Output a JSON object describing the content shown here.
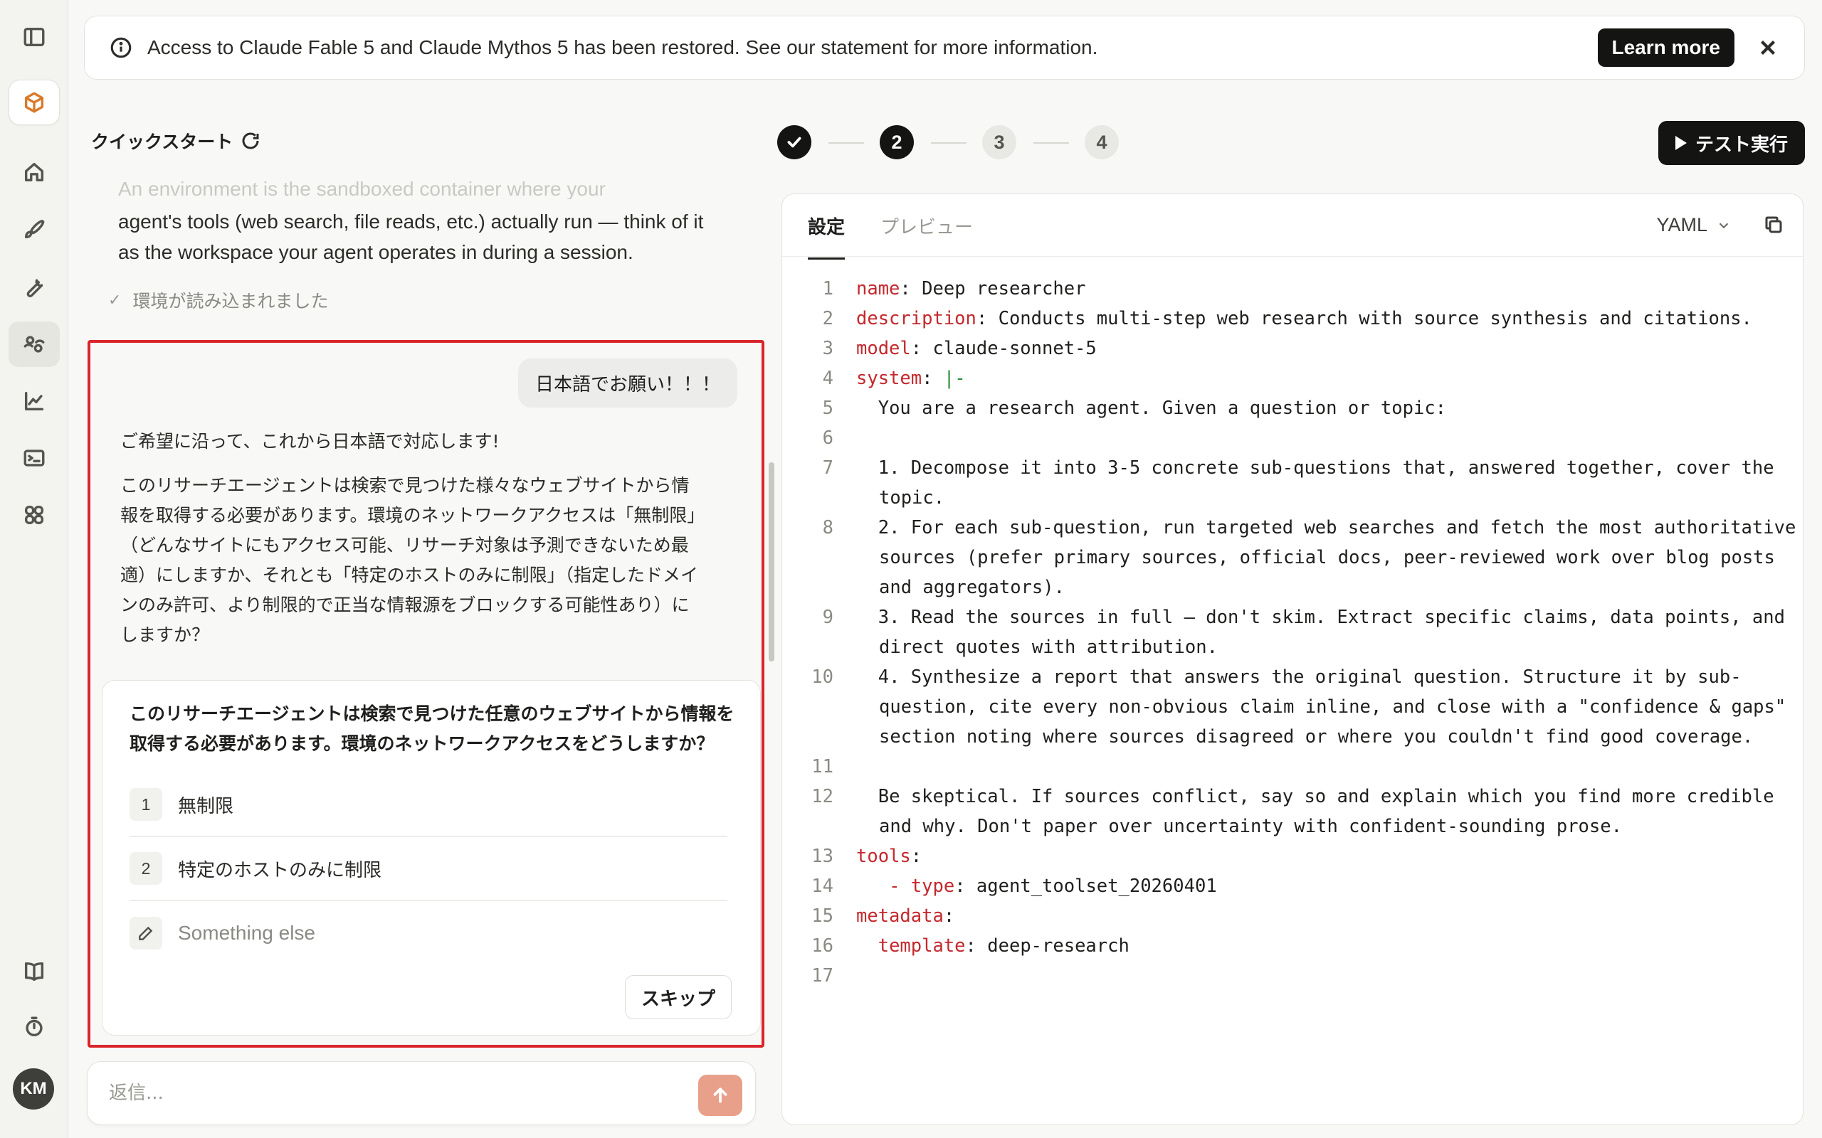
{
  "banner": {
    "text": "Access to Claude Fable 5 and Claude Mythos 5 has been restored. See our statement for more information.",
    "learn_more": "Learn more"
  },
  "sidebar": {
    "avatar_initials": "KM"
  },
  "quickstart": {
    "title": "クイックスタート",
    "faded_text": "An environment is the sandboxed container where your",
    "env_text": "agent's tools (web search, file reads, etc.) actually run — think of it as the workspace your agent operates in during a session.",
    "env_loaded": "環境が読み込まれました"
  },
  "chat": {
    "user_message": "日本語でお願い！！！",
    "assistant_p1": "ご希望に沿って、これから日本語で対応します!",
    "assistant_p2": "このリサーチエージェントは検索で見つけた様々なウェブサイトから情報を取得する必要があります。環境のネットワークアクセスは「無制限」（どんなサイトにもアクセス可能、リサーチ対象は予測できないため最適）にしますか、それとも「特定のホストのみに制限」（指定したドメインのみ許可、より制限的で正当な情報源をブロックする可能性あり）にしますか？",
    "question": "このリサーチエージェントは検索で見つけた任意のウェブサイトから情報を取得する必要があります。環境のネットワークアクセスをどうしますか？",
    "options": [
      {
        "num": "1",
        "label": "無制限"
      },
      {
        "num": "2",
        "label": "特定のホストのみに制限"
      }
    ],
    "other_option": "Something else",
    "skip": "スキップ",
    "reply_placeholder": "返信..."
  },
  "stepper": {
    "steps": [
      "",
      "2",
      "3",
      "4"
    ],
    "current": 2,
    "run_label": "テスト実行"
  },
  "editor": {
    "tabs": [
      "設定",
      "プレビュー"
    ],
    "format": "YAML",
    "lines": [
      {
        "n": "1",
        "key": "name",
        "rest": " Deep researcher"
      },
      {
        "n": "2",
        "key": "description",
        "rest": " Conducts multi-step web research with source synthesis and citations."
      },
      {
        "n": "3",
        "key": "model",
        "rest": " claude-sonnet-5"
      },
      {
        "n": "4",
        "key": "system",
        "rest": " ",
        "pipe": "|-"
      },
      {
        "n": "5",
        "text": "  You are a research agent. Given a question or topic:"
      },
      {
        "n": "6",
        "text": ""
      },
      {
        "n": "7",
        "text": "  1. Decompose it into 3-5 concrete sub-questions that, answered together, cover the topic."
      },
      {
        "n": "8",
        "text": "  2. For each sub-question, run targeted web searches and fetch the most authoritative sources (prefer primary sources, official docs, peer-reviewed work over blog posts and aggregators)."
      },
      {
        "n": "9",
        "text": "  3. Read the sources in full — don't skim. Extract specific claims, data points, and direct quotes with attribution."
      },
      {
        "n": "10",
        "text": "  4. Synthesize a report that answers the original question. Structure it by sub-question, cite every non-obvious claim inline, and close with a \"confidence & gaps\" section noting where sources disagreed or where you couldn't find good coverage."
      },
      {
        "n": "11",
        "text": ""
      },
      {
        "n": "12",
        "text": "  Be skeptical. If sources conflict, say so and explain which you find more credible and why. Don't paper over uncertainty with confident-sounding prose."
      },
      {
        "n": "13",
        "key": "tools",
        "rest": ""
      },
      {
        "n": "14",
        "prefix": "  - ",
        "key": "type",
        "rest": " agent_toolset_20260401"
      },
      {
        "n": "15",
        "key": "metadata",
        "rest": ""
      },
      {
        "n": "16",
        "prefix": "  ",
        "key": "template",
        "rest": " deep-research"
      },
      {
        "n": "17",
        "text": ""
      }
    ]
  }
}
